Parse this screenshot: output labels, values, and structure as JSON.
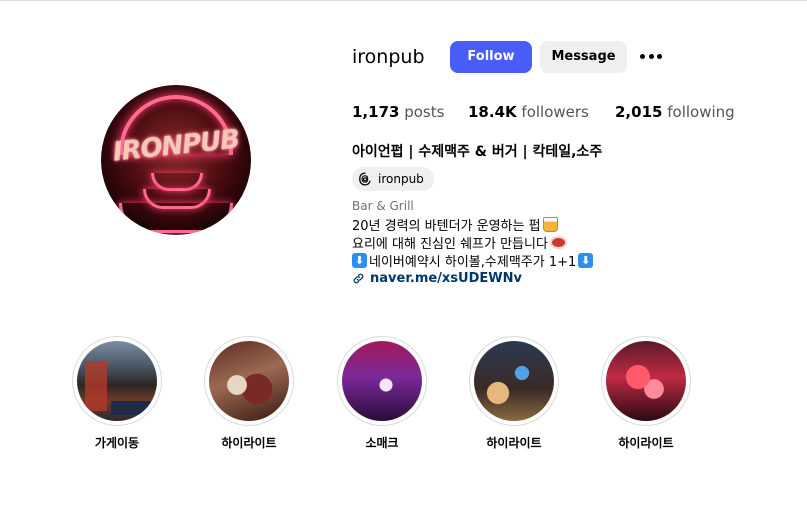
{
  "profile": {
    "username": "ironpub",
    "avatar_text": "IRONPUB",
    "follow_label": "Follow",
    "message_label": "Message",
    "more_icon": "more-dots-icon",
    "stats": {
      "posts_count": "1,173",
      "posts_label": "posts",
      "followers_count": "18.4K",
      "followers_label": "followers",
      "following_count": "2,015",
      "following_label": "following"
    },
    "full_name": "아이언펍 | 수제맥주 & 버거 | 칵테일,소주",
    "threads": {
      "icon": "threads-icon",
      "label": "ironpub"
    },
    "category": "Bar & Grill",
    "bio": {
      "line1": "20년 경력의 바텐더가 운영하는 펍",
      "line1_emoji": "beer-mug-icon",
      "line2": "요리에 대해 진심인 쉐프가 만듭니다",
      "line2_emoji": "meat-icon",
      "line3": "네이버예약시 하이볼,수제맥주가 1+1",
      "line3_emoji": "down-arrow-box-icon",
      "line3_arrow": "⬇"
    },
    "link": {
      "icon": "link-icon",
      "text": "naver.me/xsUDEWNv"
    }
  },
  "highlights": [
    {
      "label": "가게이동"
    },
    {
      "label": "하이라이트"
    },
    {
      "label": "소매크"
    },
    {
      "label": "하이라이트"
    },
    {
      "label": "하이라이트"
    }
  ],
  "colors": {
    "follow_button": "#4a5df9",
    "message_button": "#efefef",
    "link": "#00376b",
    "secondary_text": "#737373"
  }
}
